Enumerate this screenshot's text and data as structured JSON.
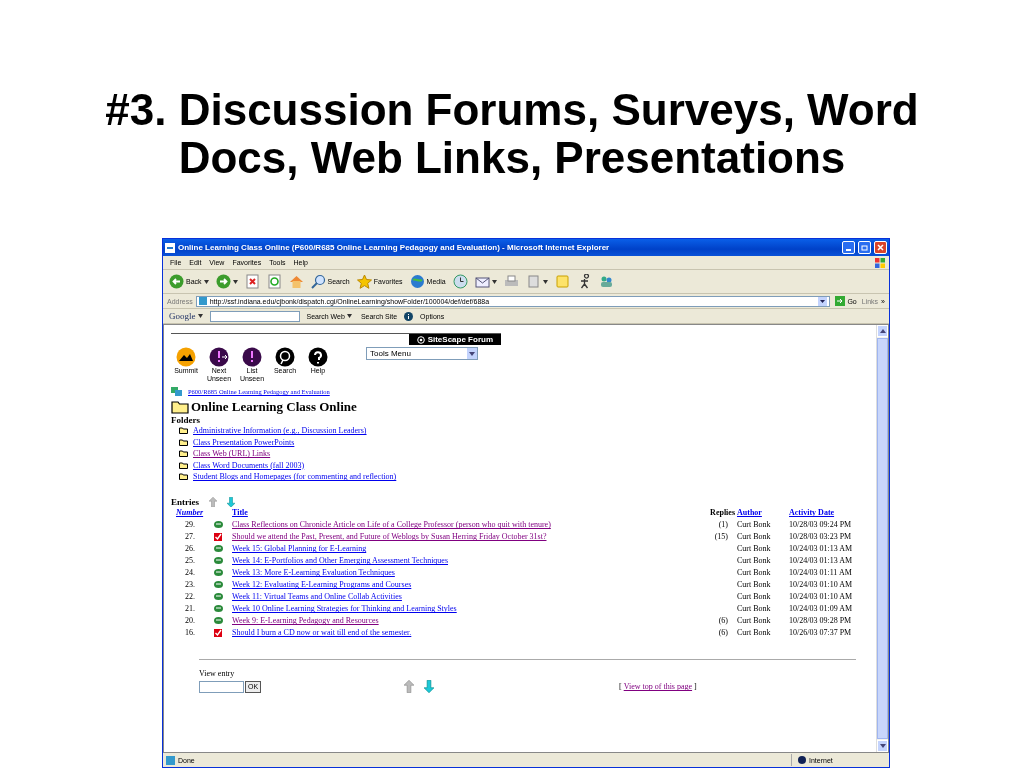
{
  "slide_title": "#3. Discussion Forums, Surveys, Word Docs, Web Links, Presentations",
  "window": {
    "title": "Online Learning Class Online (P600/R685 Online Learning Pedagogy and Evaluation) - Microsoft Internet Explorer"
  },
  "menu": [
    "File",
    "Edit",
    "View",
    "Favorites",
    "Tools",
    "Help"
  ],
  "toolbar": [
    {
      "kind": "back",
      "label": "Back",
      "dropdown": true
    },
    {
      "kind": "forward",
      "dropdown": true
    },
    {
      "kind": "stop"
    },
    {
      "kind": "refresh"
    },
    {
      "kind": "home"
    },
    {
      "kind": "search",
      "label": "Search"
    },
    {
      "kind": "favorites",
      "label": "Favorites"
    },
    {
      "kind": "media",
      "label": "Media"
    },
    {
      "kind": "history"
    },
    {
      "kind": "mail",
      "dropdown": true
    },
    {
      "kind": "print"
    },
    {
      "kind": "edit",
      "dropdown": true
    },
    {
      "kind": "note"
    },
    {
      "kind": "messenger"
    },
    {
      "kind": "people"
    }
  ],
  "address": {
    "label": "Address",
    "url": "http://ssf.indiana.edu/cjbonk/dispatch.cgi/OnlineLearning/showFolder/100004/def/def/688a",
    "go": "Go",
    "links": "Links",
    "links_more": "»"
  },
  "google_bar": {
    "logo": "Google",
    "search_web": "Search Web",
    "search_site": "Search Site",
    "options": "Options"
  },
  "forum": {
    "brand": "SiteScape Forum",
    "tools_menu": "Tools Menu",
    "nav": [
      {
        "kind": "summit",
        "label": "Summit"
      },
      {
        "kind": "next",
        "label": "Next Unseen"
      },
      {
        "kind": "list",
        "label": "List Unseen"
      },
      {
        "kind": "search",
        "label": "Search"
      },
      {
        "kind": "help",
        "label": "Help"
      }
    ],
    "breadcrumb": "P600/R685 Online Learning Pedagogy and Evaluation",
    "heading": "Online Learning Class Online",
    "folders_heading": "Folders",
    "folders": [
      {
        "label": "Administrative Information (e.g., Discussion Leaders)",
        "visited": false
      },
      {
        "label": "Class Presentation PowerPoints",
        "visited": false
      },
      {
        "label": "Class Web (URL) Links",
        "visited": true
      },
      {
        "label": "Class Word Documents (fall 2003)",
        "visited": false
      },
      {
        "label": "Student Blogs and Homepages (for commenting and reflection)",
        "visited": false
      }
    ],
    "entries_heading": "Entries",
    "columns": [
      "Number",
      "Title",
      "Replies",
      "Author",
      "Activity Date"
    ],
    "entries": [
      {
        "number": "29.",
        "kind": "discussion",
        "title": "Class Reflections on Chronicle Article on Life of a College Professor (person who quit with tenure)",
        "visited": true,
        "replies": "(1)",
        "author": "Curt Bonk",
        "date": "10/28/03 09:24 PM"
      },
      {
        "number": "27.",
        "kind": "survey",
        "title": "Should we attend the Past, Present, and Future of Weblogs by Susan Herring Friday October 31st?",
        "visited": true,
        "replies": "(15)",
        "author": "Curt Bonk",
        "date": "10/28/03 03:23 PM"
      },
      {
        "number": "26.",
        "kind": "discussion",
        "title": "Week 15: Global Planning for E-Learning",
        "visited": false,
        "author": "Curt Bonk",
        "date": "10/24/03 01:13 AM"
      },
      {
        "number": "25.",
        "kind": "discussion",
        "title": "Week 14: E-Portfolios and Other Emerging Assessment Techniques",
        "visited": false,
        "author": "Curt Bonk",
        "date": "10/24/03 01:13 AM"
      },
      {
        "number": "24.",
        "kind": "discussion",
        "title": "Week 13: More E-Learning Evaluation Techniques",
        "visited": false,
        "author": "Curt Bonk",
        "date": "10/24/03 01:11 AM"
      },
      {
        "number": "23.",
        "kind": "discussion",
        "title": "Week 12: Evaluating E-Learning Programs and Courses",
        "visited": false,
        "author": "Curt Bonk",
        "date": "10/24/03 01:10 AM"
      },
      {
        "number": "22.",
        "kind": "discussion",
        "title": "Week 11: Virtual Teams and Online Collab Activities",
        "visited": false,
        "author": "Curt Bonk",
        "date": "10/24/03 01:10 AM"
      },
      {
        "number": "21.",
        "kind": "discussion",
        "title": "Week 10 Online Learning Strategies for Thinking and Learning Styles",
        "visited": false,
        "author": "Curt Bonk",
        "date": "10/24/03 01:09 AM"
      },
      {
        "number": "20.",
        "kind": "discussion",
        "title": "Week 9: E-Learning Pedagogy and Resources",
        "visited": true,
        "replies": "(6)",
        "author": "Curt Bonk",
        "date": "10/28/03 09:28 PM"
      },
      {
        "number": "16.",
        "kind": "survey",
        "title": "Should I burn a CD now or wait till end of the semester.",
        "visited": false,
        "replies": "(6)",
        "author": "Curt Bonk",
        "date": "10/26/03 07:37 PM"
      }
    ],
    "view_entry": {
      "label": "View entry",
      "button": "OK"
    },
    "top_link": {
      "open": "[",
      "label": "View top of this page",
      "close": "]"
    }
  },
  "status_bar": {
    "text": "Done",
    "zone": "Internet"
  }
}
